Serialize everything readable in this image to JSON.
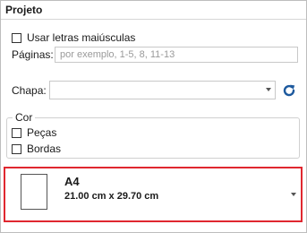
{
  "panel": {
    "title": "Projeto",
    "uppercase_checkbox": {
      "label": "Usar letras maiúsculas",
      "checked": false
    },
    "pages": {
      "label": "Páginas:",
      "placeholder": "por exemplo, 1-5, 8, 11-13",
      "value": ""
    },
    "sheet": {
      "label": "Chapa:",
      "value": "",
      "refresh_icon": "refresh-icon"
    },
    "color_group": {
      "legend": "Cor",
      "options": [
        {
          "label": "Peças",
          "checked": false
        },
        {
          "label": "Bordas",
          "checked": false
        }
      ]
    },
    "paper": {
      "name": "A4",
      "dimensions": "21.00 cm x 29.70 cm",
      "highlight_color": "#e0272f"
    }
  }
}
